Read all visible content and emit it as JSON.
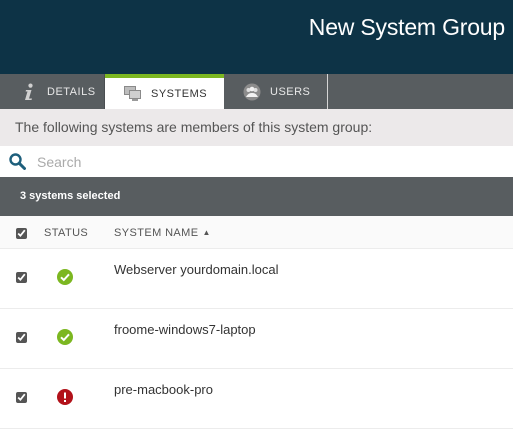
{
  "header": {
    "title": "New System Group"
  },
  "tabs": [
    {
      "label": "DETAILS",
      "icon": "info-icon",
      "active": false
    },
    {
      "label": "SYSTEMS",
      "icon": "systems-icon",
      "active": true
    },
    {
      "label": "USERS",
      "icon": "users-icon",
      "active": false
    }
  ],
  "intro_text": "The following systems are members of this system group:",
  "search": {
    "placeholder": "Search",
    "value": ""
  },
  "selection": {
    "summary": "3 systems selected"
  },
  "table": {
    "columns": {
      "status": "STATUS",
      "system_name": "SYSTEM NAME"
    },
    "sort": {
      "column": "system_name",
      "direction": "ascending"
    },
    "select_all_checked": true,
    "rows": [
      {
        "checked": true,
        "status": "ok",
        "name": "Webserver yourdomain.local"
      },
      {
        "checked": true,
        "status": "ok",
        "name": "froome-windows7-laptop"
      },
      {
        "checked": true,
        "status": "error",
        "name": "pre-macbook-pro"
      }
    ]
  },
  "colors": {
    "header_bg": "#0d3346",
    "tab_bar_bg": "#585d60",
    "active_tab_accent": "#7cb721",
    "status_ok": "#7cb721",
    "status_error": "#b2121a",
    "search_icon": "#1e5f7c"
  }
}
